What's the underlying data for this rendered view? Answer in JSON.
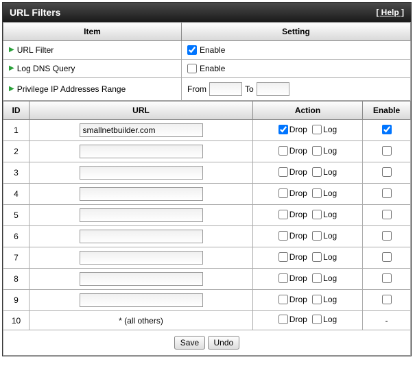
{
  "title": "URL Filters",
  "help_label": "[ Help ]",
  "headers": {
    "item": "Item",
    "setting": "Setting",
    "id": "ID",
    "url": "URL",
    "action": "Action",
    "enable": "Enable"
  },
  "settings": {
    "url_filter": {
      "label": "URL Filter",
      "checkbox_label": "Enable",
      "checked": true
    },
    "log_dns": {
      "label": "Log DNS Query",
      "checkbox_label": "Enable",
      "checked": false
    },
    "priv_ip": {
      "label": "Privilege IP Addresses Range",
      "from_label": "From",
      "to_label": "To",
      "from_value": "",
      "to_value": ""
    }
  },
  "action_labels": {
    "drop": "Drop",
    "log": "Log"
  },
  "rows": [
    {
      "id": "1",
      "url": "smallnetbuilder.com",
      "drop": true,
      "log": false,
      "enable": true
    },
    {
      "id": "2",
      "url": "",
      "drop": false,
      "log": false,
      "enable": false
    },
    {
      "id": "3",
      "url": "",
      "drop": false,
      "log": false,
      "enable": false
    },
    {
      "id": "4",
      "url": "",
      "drop": false,
      "log": false,
      "enable": false
    },
    {
      "id": "5",
      "url": "",
      "drop": false,
      "log": false,
      "enable": false
    },
    {
      "id": "6",
      "url": "",
      "drop": false,
      "log": false,
      "enable": false
    },
    {
      "id": "7",
      "url": "",
      "drop": false,
      "log": false,
      "enable": false
    },
    {
      "id": "8",
      "url": "",
      "drop": false,
      "log": false,
      "enable": false
    },
    {
      "id": "9",
      "url": "",
      "drop": false,
      "log": false,
      "enable": false
    }
  ],
  "last_row": {
    "id": "10",
    "url_text": "* (all others)",
    "drop": false,
    "log": false,
    "enable_text": "-"
  },
  "buttons": {
    "save": "Save",
    "undo": "Undo"
  }
}
